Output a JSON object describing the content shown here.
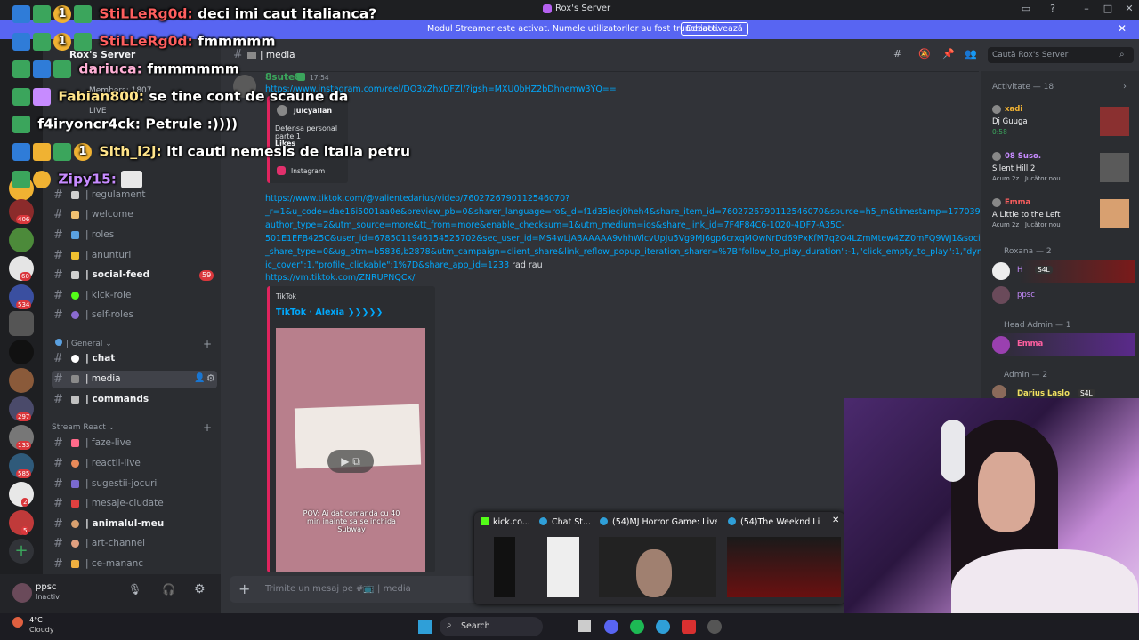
{
  "window": {
    "title": "Rox's Server"
  },
  "banner": {
    "text": "Modul Streamer este activat. Numele utilizatorilor au fost trunchiate.",
    "button": "Dezactivează"
  },
  "server": {
    "name": "Rox's Server",
    "members_label": "Members: 1807",
    "live_label": "LIVE"
  },
  "rail_badges": [
    "406",
    "60",
    "534",
    "297",
    "133",
    "585",
    "2",
    "5"
  ],
  "channels": {
    "top": [
      {
        "name": "| regulament"
      },
      {
        "name": "| welcome"
      },
      {
        "name": "| roles"
      },
      {
        "name": "| anunturi"
      },
      {
        "name": "| social-feed",
        "badge": "59"
      },
      {
        "name": "| kick-role"
      },
      {
        "name": "| self-roles"
      }
    ],
    "cat_general": "| General",
    "general": [
      {
        "name": "| chat"
      },
      {
        "name": "| media"
      },
      {
        "name": "| commands"
      }
    ],
    "cat_stream": "Stream React",
    "stream": [
      {
        "name": "| faze-live"
      },
      {
        "name": "| reactii-live"
      },
      {
        "name": "| sugestii-jocuri"
      },
      {
        "name": "| mesaje-ciudate"
      },
      {
        "name": "| animalul-meu"
      },
      {
        "name": "| art-channel"
      },
      {
        "name": "| ce-mananc"
      }
    ]
  },
  "user": {
    "name": "ppsc",
    "status": "Inactiv"
  },
  "header": {
    "channel": "| media",
    "search_placeholder": "Caută Rox's Server"
  },
  "message": {
    "author": "8sute8",
    "time": "17:54",
    "link1": "https://www.instagram.com/reel/DO3xZhxDFZl/?igsh=MXU0bHZ2bDhnemw3YQ==",
    "embed1": {
      "user": "juicyallan",
      "desc": "Defensa personal parte 1",
      "likes": "Likes",
      "source": "Instagram"
    },
    "link2_lines": [
      "https://www.tiktok.com/@valientedarius/video/7602726790112546070?",
      "_r=1&u_code=dae16i5001aa0e&preview_pb=0&sharer_language=ro&_d=f1d35iecj0heh4&share_item_id=7602726790112546070&source=h5_m&timestamp=1770393510&ir",
      "author_type=2&utm_source=more&tt_from=more&enable_checksum=1&utm_medium=ios&share_link_id=7F4F84C6-1020-4DF7-A35C-",
      "501E1EFB425C&user_id=6785011946154525702&sec_user_id=MS4wLjABAAAAA9vhhWlcvUpJu5Vg9MJ6gp6crxqMOwNrDd69PxKfM7q2O4LZmMtew4ZZ0mFQ9WJ1&social",
      "_share_type=0&ug_btm=b5836,b2878&utm_campaign=client_share&link_reflow_popup_iteration_sharer=%7B\"follow_to_play_duration\":-1,\"click_empty_to_play\":1,\"dynar",
      "ic_cover\":1,\"profile_clickable\":1%7D&share_app_id=1233"
    ],
    "link2_suffix": " rad rau",
    "link3": "https://vm.tiktok.com/ZNRUPNQCx/",
    "embed2": {
      "provider": "TikTok",
      "title": "TikTok · Alexia ❯❯❯❯❯",
      "caption": "POV: Ai dat comanda cu 40 min inainte sa se inchida Subway"
    }
  },
  "input": {
    "placeholder": "Trimite un mesaj pe #📺 | media"
  },
  "members": {
    "activity_header": "Activitate — 18",
    "activities": [
      {
        "name": "xadi",
        "title": "Dj Guuga",
        "sub": "0:58"
      },
      {
        "name": "08 Suso.",
        "title": "Silent Hill 2",
        "sub": "Acum 2z",
        "extra": "Jucător nou"
      },
      {
        "name": "Emma",
        "title": "A Little to the Left",
        "sub": "Acum 2z",
        "extra": "Jucător nou"
      }
    ],
    "roxana_header": "Roxana — 2",
    "roxana_members": [
      "H",
      "ppsc"
    ],
    "roxana_tag": "S4L",
    "headadmin_header": "Head Admin — 1",
    "headadmin_members": [
      "Emma"
    ],
    "admin_header": "Admin — 2",
    "admin_members": [
      "Darius Laslo"
    ],
    "admin_tag": "S4L"
  },
  "overlay_chat": [
    {
      "user": "StiLLeRg0d:",
      "msg": "deci imi caut italianca?"
    },
    {
      "user": "StiLLeRg0d:",
      "msg": "fmmmmm"
    },
    {
      "user": "dariuca:",
      "msg": "fmmmmmm"
    },
    {
      "user": "Fabian800:",
      "msg": "se tine cont de scaune da"
    },
    {
      "user": "f4iryoncr4ck:",
      "msg": "Petrule :))))"
    },
    {
      "user": "Sith_i2j:",
      "msg": "iti cauti nemesis de italia petru"
    },
    {
      "user": "Zipy15:",
      "msg": ""
    }
  ],
  "overlay_badge_num": "1",
  "thumbnails": [
    {
      "label": "kick.co..."
    },
    {
      "label": "Chat St..."
    },
    {
      "label": "(54)MJ Horror Game: Live..."
    },
    {
      "label": "(54)The Weeknd Liv..."
    }
  ],
  "taskbar": {
    "temp": "4°C",
    "weather": "Cloudy",
    "search": "Search"
  },
  "colors": {
    "blurple": "#5865f2",
    "link": "#00a8fc",
    "bg": "#313338",
    "sidebar": "#2b2d31",
    "rail": "#1e1f22",
    "green_name": "#3ba55c"
  }
}
